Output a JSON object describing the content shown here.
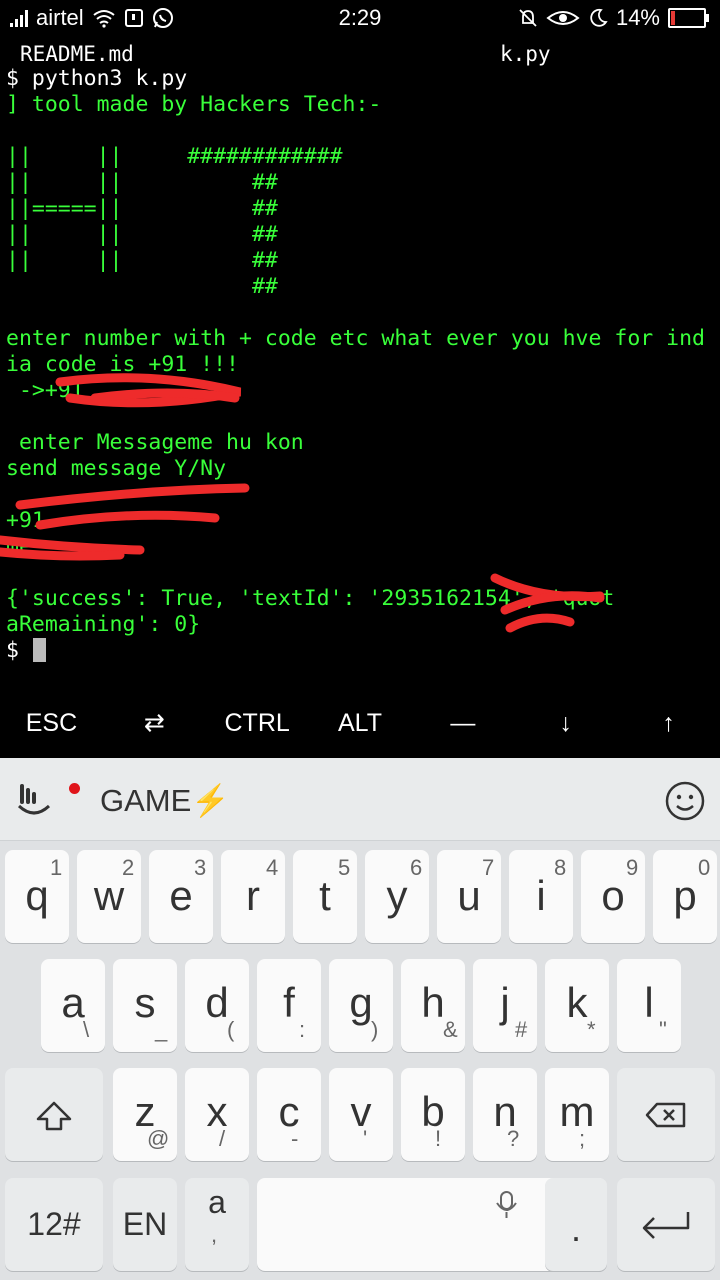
{
  "status": {
    "carrier": "airtel",
    "time": "2:29",
    "battery": "14%",
    "battery_level": 0.14
  },
  "tabs": {
    "left": "README.md",
    "right": "k.py"
  },
  "terminal": {
    "lines": [
      {
        "text": "$ python3 k.py",
        "color": "white"
      },
      {
        "text": "] tool made by Hackers Tech:-",
        "color": "green"
      },
      {
        "text": "",
        "color": "green"
      },
      {
        "text": "||     ||     ############",
        "color": "green"
      },
      {
        "text": "||     ||          ##",
        "color": "green"
      },
      {
        "text": "||=====||          ##",
        "color": "green"
      },
      {
        "text": "||     ||          ##",
        "color": "green"
      },
      {
        "text": "||     ||          ##",
        "color": "green"
      },
      {
        "text": "                   ##",
        "color": "green"
      },
      {
        "text": "",
        "color": "green"
      },
      {
        "text": "enter number with + code etc what ever you hve for ind",
        "color": "green"
      },
      {
        "text": "ia code is +91 !!!",
        "color": "green"
      },
      {
        "text": " ->+91",
        "color": "green"
      },
      {
        "text": "",
        "color": "green"
      },
      {
        "text": " enter Messageme hu kon",
        "color": "green"
      },
      {
        "text": "send message Y/Ny",
        "color": "green"
      },
      {
        "text": "",
        "color": "green"
      },
      {
        "text": "+91",
        "color": "green"
      },
      {
        "text": "me",
        "color": "green"
      },
      {
        "text": "",
        "color": "green"
      },
      {
        "text": "{'success': True, 'textId': '2935162154', 'quot",
        "color": "green"
      },
      {
        "text": "aRemaining': 0}",
        "color": "green"
      }
    ],
    "prompt": "$"
  },
  "extra_keys": [
    "ESC",
    "⇄",
    "CTRL",
    "ALT",
    "—",
    "↓",
    "↑"
  ],
  "keyboard": {
    "toolbar_label": "GAME⚡",
    "row1": [
      {
        "k": "q",
        "s": "1"
      },
      {
        "k": "w",
        "s": "2"
      },
      {
        "k": "e",
        "s": "3"
      },
      {
        "k": "r",
        "s": "4"
      },
      {
        "k": "t",
        "s": "5"
      },
      {
        "k": "y",
        "s": "6"
      },
      {
        "k": "u",
        "s": "7"
      },
      {
        "k": "i",
        "s": "8"
      },
      {
        "k": "o",
        "s": "9"
      },
      {
        "k": "p",
        "s": "0"
      }
    ],
    "row2": [
      {
        "k": "a",
        "s": "\\"
      },
      {
        "k": "s",
        "s": "_"
      },
      {
        "k": "d",
        "s": "("
      },
      {
        "k": "f",
        "s": ":"
      },
      {
        "k": "g",
        "s": ")"
      },
      {
        "k": "h",
        "s": "&"
      },
      {
        "k": "j",
        "s": "#"
      },
      {
        "k": "k",
        "s": "*"
      },
      {
        "k": "l",
        "s": "\""
      }
    ],
    "row3": [
      {
        "k": "z",
        "s": "@"
      },
      {
        "k": "x",
        "s": "/"
      },
      {
        "k": "c",
        "s": "-"
      },
      {
        "k": "v",
        "s": "'"
      },
      {
        "k": "b",
        "s": "!"
      },
      {
        "k": "n",
        "s": "?"
      },
      {
        "k": "m",
        "s": ";"
      }
    ],
    "numbers_label": "12#",
    "lang_label": "EN",
    "comma_main": "a",
    "comma_sub": ",",
    "period_label": "."
  }
}
